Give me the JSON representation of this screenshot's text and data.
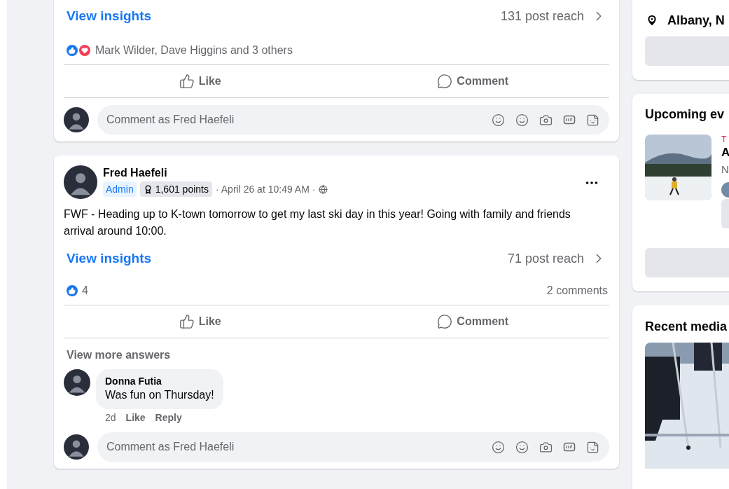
{
  "posts": [
    {
      "insights": {
        "link": "View insights",
        "reach": "131 post reach"
      },
      "reactions": {
        "icons": [
          {
            "kind": "like"
          },
          {
            "kind": "love"
          }
        ],
        "text": "Mark Wilder, Dave Higgins and 3 others"
      },
      "actions": [
        "Like",
        "Comment"
      ],
      "composer": {
        "placeholder": "Comment as Fred Haefeli"
      }
    },
    {
      "author": "Fred Haefeli",
      "badges": [
        {
          "kind": "role",
          "text": "Admin"
        },
        {
          "kind": "points",
          "text": "1,601 points"
        }
      ],
      "time": "· April 26 at 10:49 AM ·",
      "body": "FWF - Heading up to K-town tomorrow to get my last ski day in this year! Going with family and friends arrival around 10:00.",
      "insights": {
        "link": "View insights",
        "reach": "71 post reach"
      },
      "reactions": {
        "icons": [
          {
            "kind": "like"
          }
        ],
        "text": "4"
      },
      "comments_count": "2 comments",
      "actions": [
        "Like",
        "Comment"
      ],
      "more": "View more answers",
      "comments": [
        {
          "author": "Donna Futia",
          "text": "Was fun on Thursday!",
          "age": "2d",
          "actions": [
            "Like",
            "Reply"
          ]
        }
      ],
      "composer": {
        "placeholder": "Comment as Fred Haefeli"
      }
    }
  ],
  "sidebar": {
    "location": "Albany, N",
    "events": {
      "title": "Upcoming ev",
      "item": {
        "date": "T",
        "name": "A",
        "sub": "N"
      }
    },
    "media": {
      "title": "Recent media"
    }
  }
}
